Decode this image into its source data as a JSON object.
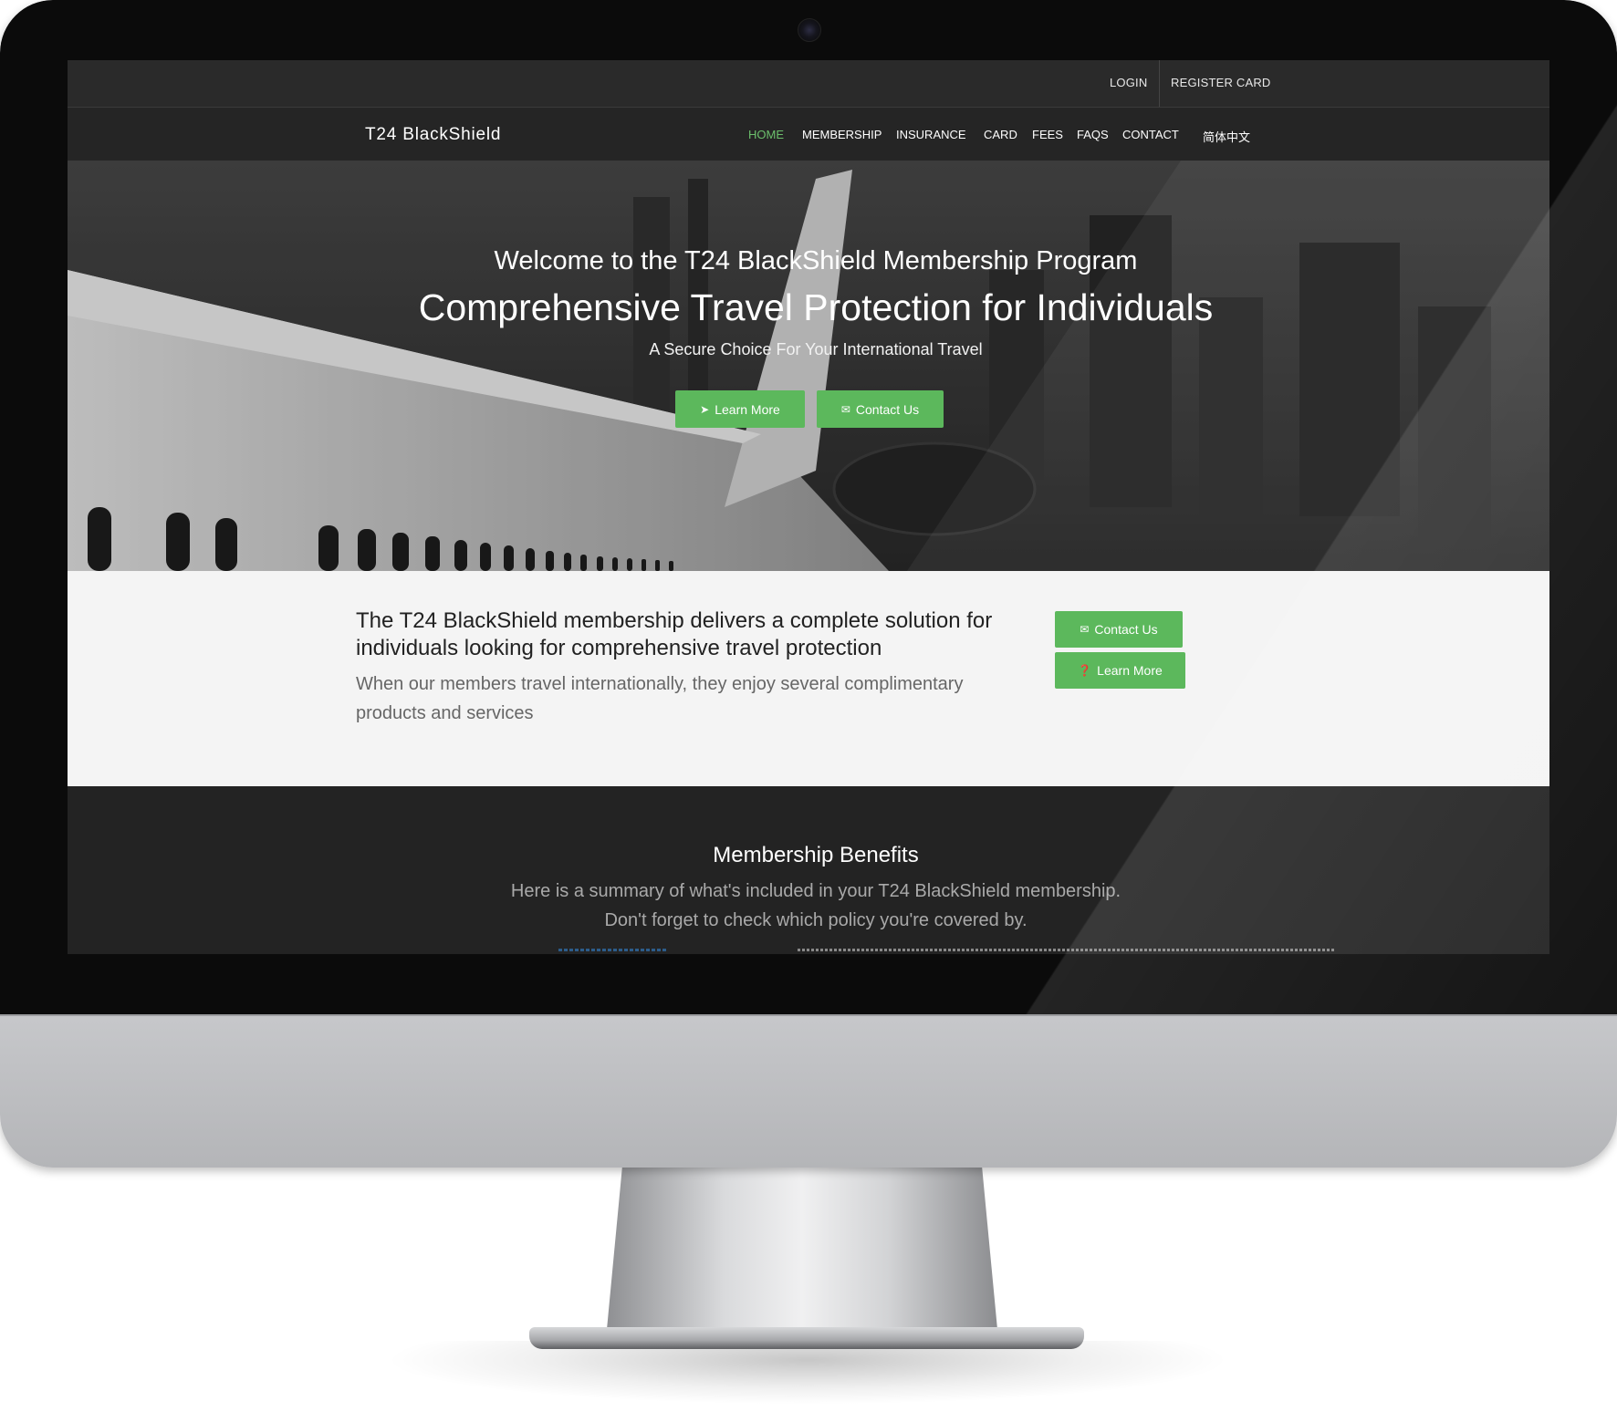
{
  "topbar": {
    "login": "LOGIN",
    "register": "REGISTER CARD"
  },
  "nav": {
    "logo": "T24 BlackShield",
    "items": [
      {
        "label": "HOME",
        "active": true
      },
      {
        "label": "MEMBERSHIP"
      },
      {
        "label": "INSURANCE"
      },
      {
        "label": "CARD"
      },
      {
        "label": "FEES"
      },
      {
        "label": "FAQS"
      },
      {
        "label": "CONTACT"
      },
      {
        "label": "简体中文"
      }
    ]
  },
  "hero": {
    "welcome": "Welcome to the T24 BlackShield Membership Program",
    "headline": "Comprehensive Travel Protection for Individuals",
    "subline": "A Secure Choice For Your International Travel",
    "learn_more": "Learn More",
    "contact_us": "Contact Us"
  },
  "intro": {
    "title": "The T24 BlackShield membership delivers a complete solution for individuals looking for comprehensive travel protection",
    "text": "When our members travel internationally, they enjoy several complimentary products and services",
    "contact_us": "Contact Us",
    "learn_more": "Learn More"
  },
  "benefits": {
    "title": "Membership Benefits",
    "line1": "Here is a summary of what's included in your T24 BlackShield membership.",
    "line2": "Don't forget to check which policy you're covered by."
  },
  "icons": {
    "learn_more_hero": "circle-chevron-right-icon",
    "contact": "envelope-icon",
    "learn_more_intro": "question-circle-icon"
  },
  "colors": {
    "accent_green": "#5cb85c",
    "active_nav": "#6cbf6c",
    "dark_bg": "#232323",
    "light_section": "#f4f4f4"
  }
}
